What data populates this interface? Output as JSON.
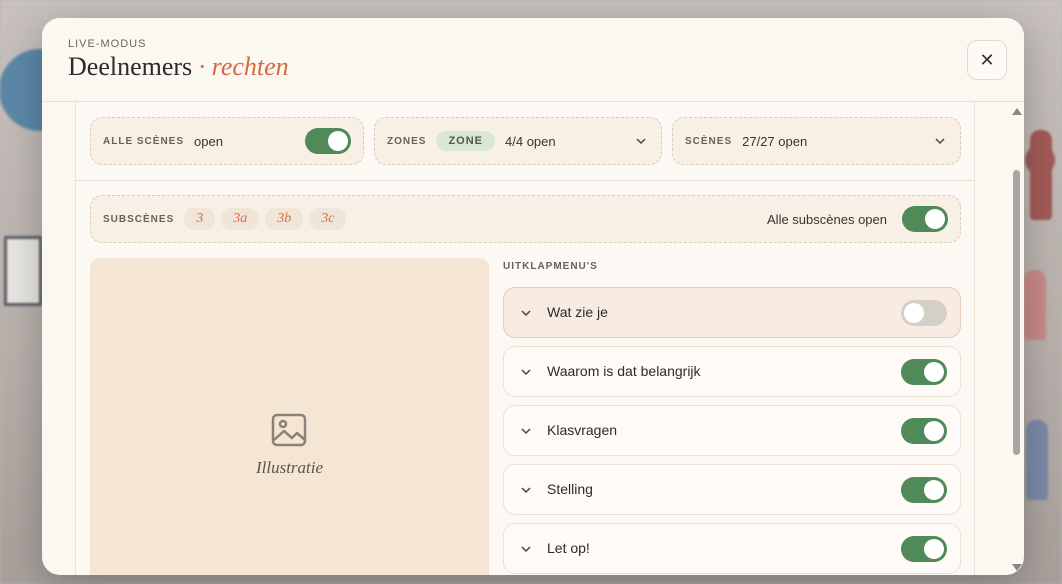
{
  "header": {
    "eyebrow": "LIVE-MODUS",
    "title": "Deelnemers",
    "title_accent": "· rechten",
    "close_label": "✕"
  },
  "filters": {
    "all_scenes": {
      "label": "ALLE SCÈNES",
      "value": "open",
      "toggle_on": true
    },
    "zones": {
      "label": "ZONES",
      "badge": "ZONE",
      "value": "4/4 open"
    },
    "scenes": {
      "label": "SCÈNES",
      "value": "27/27 open"
    }
  },
  "subscenes": {
    "label": "SUBSCÈNES",
    "chips": [
      "3",
      "3a",
      "3b",
      "3c"
    ],
    "all_open_label": "Alle subscènes open",
    "all_open_toggle_on": true
  },
  "illustration": {
    "label": "Illustratie",
    "icon": "image-icon"
  },
  "dropdowns": {
    "label": "UITKLAPMENU'S",
    "items": [
      {
        "label": "Wat zie je",
        "on": false
      },
      {
        "label": "Waarom is dat belangrijk",
        "on": true
      },
      {
        "label": "Klasvragen",
        "on": true
      },
      {
        "label": "Stelling",
        "on": true
      },
      {
        "label": "Let op!",
        "on": true
      }
    ]
  },
  "colors": {
    "accent": "#d7693f",
    "toggle_on": "#4f8a58",
    "toggle_off": "#d5cfc9",
    "panel_bg": "#fcf8f3"
  }
}
